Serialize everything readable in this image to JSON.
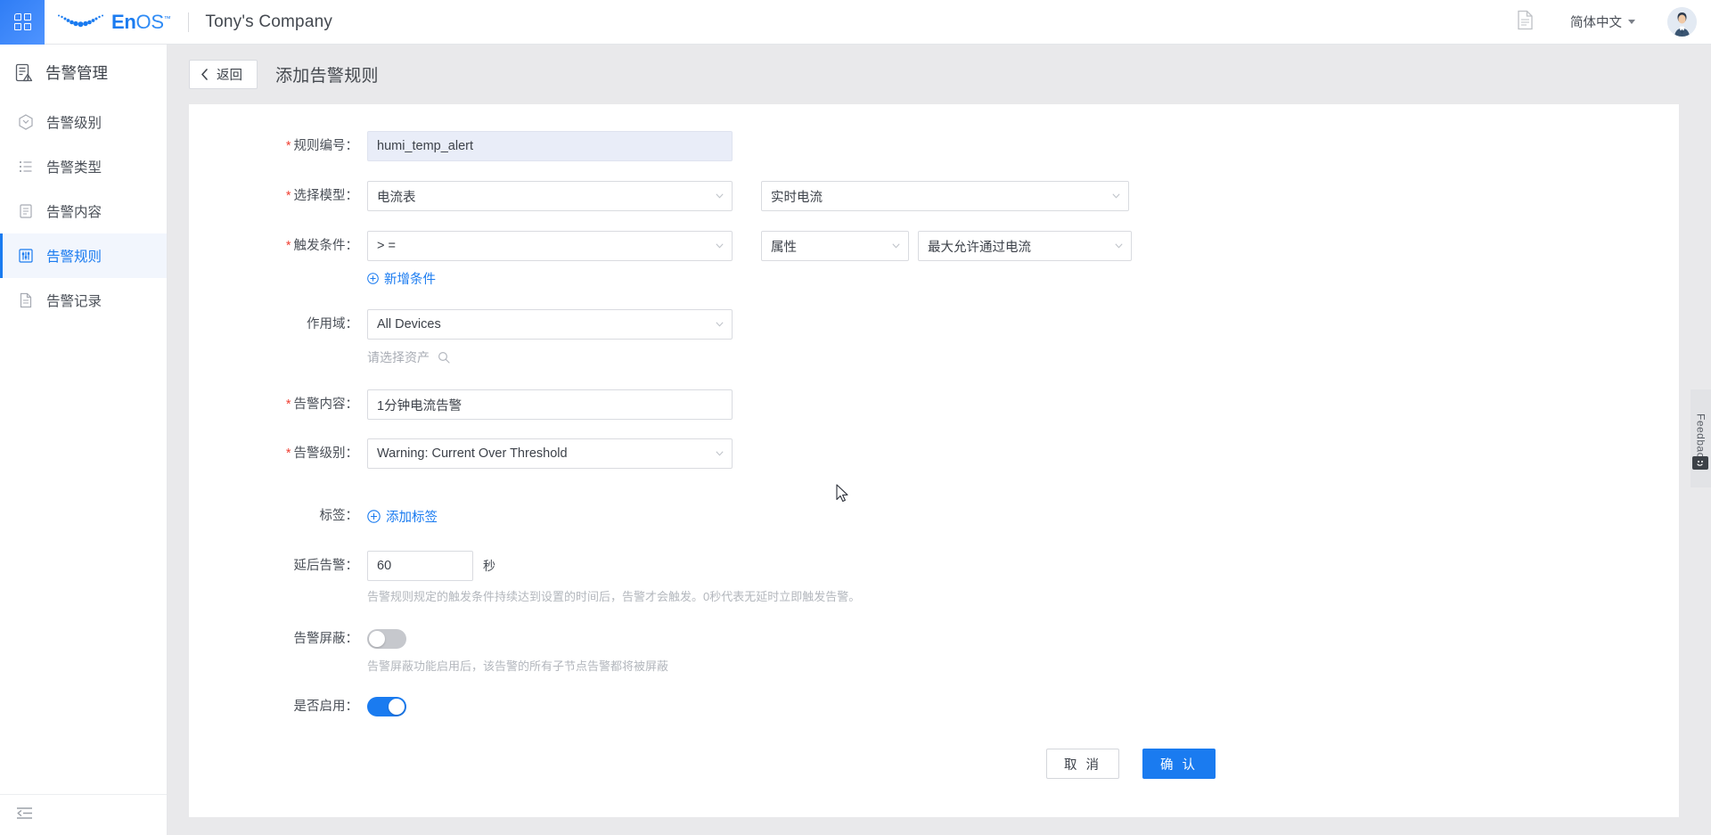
{
  "header": {
    "apps_icon": "apps-grid-icon",
    "logo_text_bold": "En",
    "logo_text_light": "OS",
    "logo_tm": "™",
    "tenant": "Tony's Company",
    "doc_icon": "document-icon",
    "language": "简体中文",
    "avatar": "user-avatar"
  },
  "sidebar": {
    "title": "告警管理",
    "title_icon": "alarm-management-icon",
    "items": [
      {
        "label": "告警级别",
        "icon": "alarm-level-icon",
        "active": false
      },
      {
        "label": "告警类型",
        "icon": "alarm-type-icon",
        "active": false
      },
      {
        "label": "告警内容",
        "icon": "alarm-content-icon",
        "active": false
      },
      {
        "label": "告警规则",
        "icon": "alarm-rule-icon",
        "active": true
      },
      {
        "label": "告警记录",
        "icon": "alarm-record-icon",
        "active": false
      }
    ],
    "collapse_icon": "menu-fold-icon"
  },
  "page": {
    "back_label": "返回",
    "title": "添加告警规则"
  },
  "form": {
    "rule_id": {
      "label": "规则编号：",
      "required": true,
      "value": "humi_temp_alert",
      "focused": true
    },
    "model": {
      "label": "选择模型：",
      "required": true,
      "value": "电流表",
      "secondary_value": "实时电流"
    },
    "trigger": {
      "label": "触发条件：",
      "required": true,
      "operator": ">  =",
      "attr_type": "属性",
      "attr_name": "最大允许通过电流",
      "add_condition": "新增条件"
    },
    "scope": {
      "label": "作用域：",
      "required": false,
      "value": "All Devices",
      "asset_placeholder": "请选择资产"
    },
    "content": {
      "label": "告警内容：",
      "required": true,
      "value": "1分钟电流告警"
    },
    "level": {
      "label": "告警级别：",
      "required": true,
      "value": "Warning: Current Over Threshold"
    },
    "tags": {
      "label": "标签：",
      "required": false,
      "add_label": "添加标签"
    },
    "delay": {
      "label": "延后告警：",
      "required": false,
      "value": "60",
      "unit": "秒",
      "hint": "告警规则规定的触发条件持续达到设置的时间后，告警才会触发。0秒代表无延时立即触发告警。"
    },
    "mask": {
      "label": "告警屏蔽：",
      "required": false,
      "enabled": false,
      "hint": "告警屏蔽功能启用后，该告警的所有子节点告警都将被屏蔽"
    },
    "enable": {
      "label": "是否启用：",
      "required": false,
      "enabled": true
    },
    "cancel_label": "取 消",
    "confirm_label": "确 认"
  },
  "feedback": {
    "label": "Feedback",
    "smiley_icon": "smiley-icon"
  },
  "colors": {
    "accent": "#1a7bf0",
    "required": "#f04134",
    "page_bg": "#e9e9eb",
    "toggle_off": "#c6c8cd"
  }
}
